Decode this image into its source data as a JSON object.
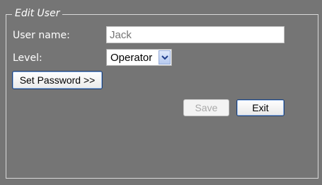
{
  "dialog": {
    "title": "Edit User"
  },
  "form": {
    "username_label": "User name:",
    "username_value": "",
    "username_placeholder": "Jack",
    "level_label": "Level:",
    "level_value": "Operator",
    "level_arrow_icon": "chevron-down-icon"
  },
  "buttons": {
    "set_password": "Set Password >>",
    "save": "Save",
    "exit": "Exit"
  },
  "colors": {
    "panel_background": "#757575",
    "label_text": "#ffffff",
    "disabled_text": "#a9a9a9",
    "select_arrow": "#1f3d8a"
  }
}
